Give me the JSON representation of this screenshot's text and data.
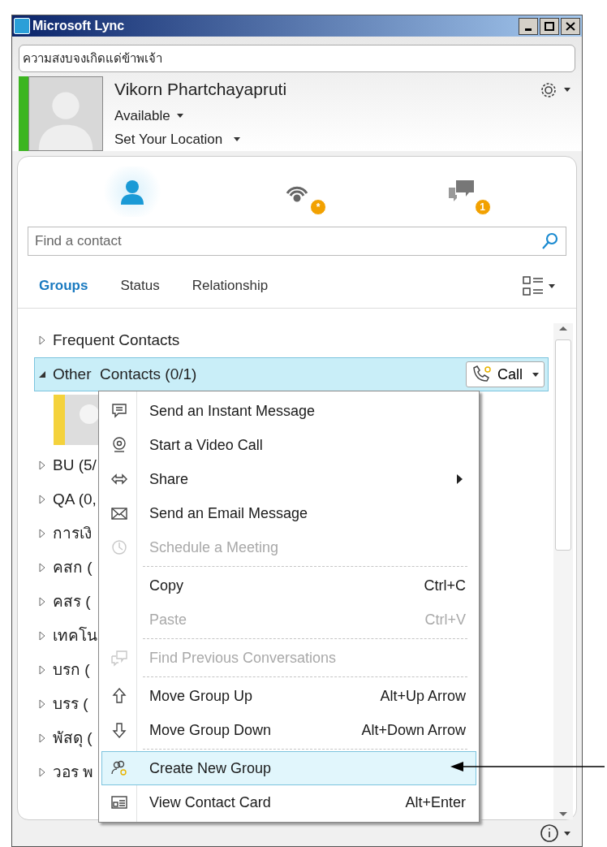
{
  "window": {
    "title": "Microsoft Lync"
  },
  "note": {
    "value": "ความสงบจงเกิดแด่ข้าพเจ้า"
  },
  "profile": {
    "name": "Vikorn Phartchayapruti",
    "status": "Available",
    "location": "Set Your Location",
    "color": "#3cb521"
  },
  "views": [
    {
      "kind": "contacts",
      "selected": true
    },
    {
      "kind": "activity",
      "selected": false,
      "badge": "*"
    },
    {
      "kind": "conversations",
      "selected": false,
      "badge": "1"
    }
  ],
  "search": {
    "placeholder": "Find a contact"
  },
  "tabs": [
    {
      "label": "Groups",
      "selected": true
    },
    {
      "label": "Status",
      "selected": false
    },
    {
      "label": "Relationship",
      "selected": false
    }
  ],
  "groups": [
    {
      "kind": "group",
      "label": "Frequent Contacts",
      "expanded": false,
      "selected": false
    },
    {
      "kind": "group",
      "label": "Other  Contacts (0/1)",
      "expanded": true,
      "selected": true,
      "action": "Call"
    },
    {
      "kind": "contact",
      "color": "#f4d23c"
    },
    {
      "kind": "group",
      "label": "BU (5/",
      "expanded": false,
      "selected": false
    },
    {
      "kind": "group",
      "label": "QA (0,",
      "expanded": false,
      "selected": false
    },
    {
      "kind": "group",
      "label": "การเงิ",
      "expanded": false,
      "selected": false
    },
    {
      "kind": "group",
      "label": "คสก (",
      "expanded": false,
      "selected": false
    },
    {
      "kind": "group",
      "label": "คสร (",
      "expanded": false,
      "selected": false
    },
    {
      "kind": "group",
      "label": "เทคโน",
      "expanded": false,
      "selected": false
    },
    {
      "kind": "group",
      "label": "บรก (",
      "expanded": false,
      "selected": false
    },
    {
      "kind": "group",
      "label": "บรร (",
      "expanded": false,
      "selected": false
    },
    {
      "kind": "group",
      "label": "พัสดุ (",
      "expanded": false,
      "selected": false
    },
    {
      "kind": "group",
      "label": "วอร พ",
      "expanded": false,
      "selected": false
    }
  ],
  "menu": [
    {
      "kind": "item",
      "label": "Send an Instant Message",
      "disabled": false,
      "selected": false
    },
    {
      "kind": "item",
      "label": "Start a Video Call",
      "disabled": false,
      "selected": false
    },
    {
      "kind": "item",
      "label": "Share",
      "disabled": false,
      "selected": false,
      "submenu": true
    },
    {
      "kind": "item",
      "label": "Send an Email Message",
      "disabled": false,
      "selected": false
    },
    {
      "kind": "item",
      "label": "Schedule a Meeting",
      "disabled": true,
      "selected": false
    },
    {
      "kind": "separator"
    },
    {
      "kind": "item",
      "label": "Copy",
      "shortcut": "Ctrl+C",
      "disabled": false,
      "selected": false
    },
    {
      "kind": "item",
      "label": "Paste",
      "shortcut": "Ctrl+V",
      "disabled": true,
      "selected": false
    },
    {
      "kind": "separator"
    },
    {
      "kind": "item",
      "label": "Find Previous Conversations",
      "disabled": true,
      "selected": false
    },
    {
      "kind": "separator"
    },
    {
      "kind": "item",
      "label": "Move Group Up",
      "shortcut": "Alt+Up Arrow",
      "disabled": false,
      "selected": false
    },
    {
      "kind": "item",
      "label": "Move Group Down",
      "shortcut": "Alt+Down Arrow",
      "disabled": false,
      "selected": false
    },
    {
      "kind": "separator"
    },
    {
      "kind": "item",
      "label": "Create New Group",
      "disabled": false,
      "selected": true
    },
    {
      "kind": "item",
      "label": "View Contact Card",
      "shortcut": "Alt+Enter",
      "disabled": false,
      "selected": false
    }
  ]
}
